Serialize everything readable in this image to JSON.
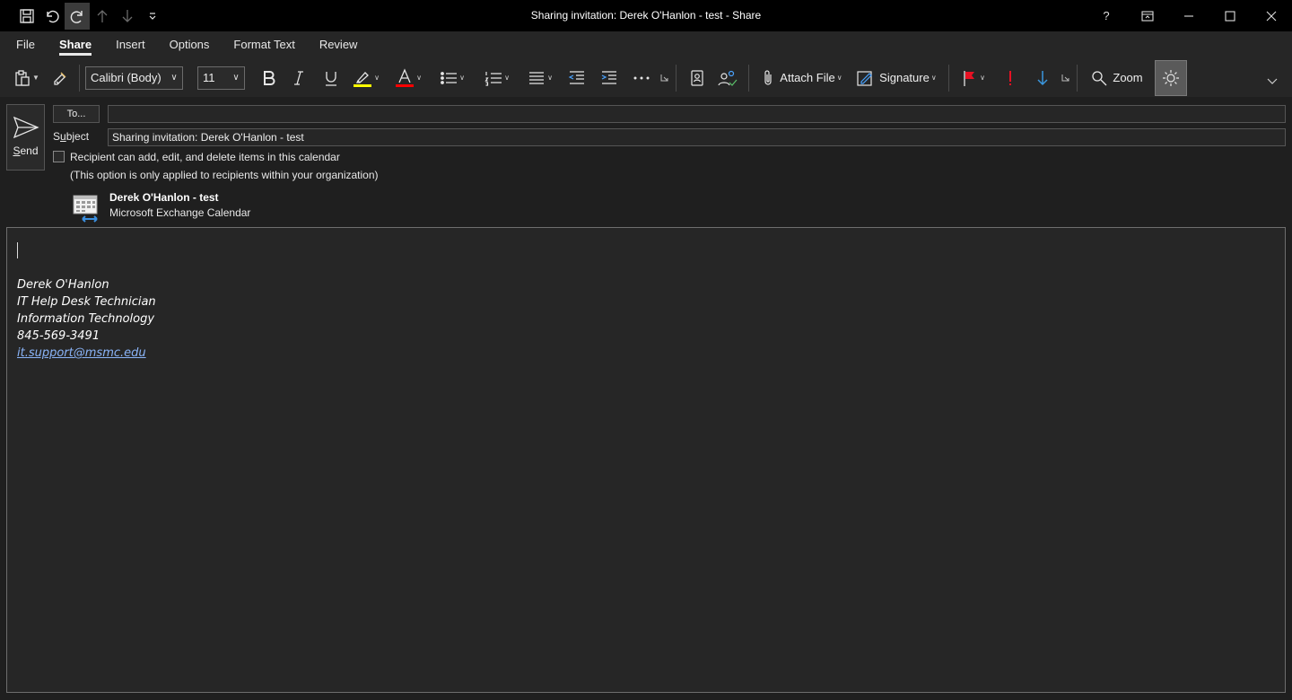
{
  "window": {
    "title": "Sharing invitation: Derek O'Hanlon - test  -  Share",
    "help": "?"
  },
  "tabs": [
    {
      "label": "File"
    },
    {
      "label": "Share"
    },
    {
      "label": "Insert"
    },
    {
      "label": "Options"
    },
    {
      "label": "Format Text"
    },
    {
      "label": "Review"
    }
  ],
  "active_tab": "Share",
  "toolbar": {
    "font_name": "Calibri (Body)",
    "font_size": "11",
    "attach_label": "Attach File",
    "signature_label": "Signature",
    "zoom_label": "Zoom",
    "highlight_color": "#ffff00",
    "font_color": "#ff0000",
    "flag_color": "#e81123",
    "importance_high_color": "#e81123",
    "importance_low_color": "#3a96dd"
  },
  "compose": {
    "send_label": "Send",
    "to_label": "To...",
    "to_value": "",
    "subject_label": "Subject",
    "subject_value": "Sharing invitation: Derek O'Hanlon - test",
    "permission_label": "Recipient can add, edit, and delete items in this calendar",
    "permission_checked": false,
    "permission_note": "(This option is only applied to recipients within your organization)",
    "calendar_name": "Derek O'Hanlon - test",
    "calendar_type": "Microsoft Exchange Calendar"
  },
  "signature": {
    "name": "Derek O'Hanlon",
    "title": "IT Help Desk Technician",
    "department": "Information Technology",
    "phone": "845-569-3491",
    "email": "it.support@msmc.edu"
  }
}
